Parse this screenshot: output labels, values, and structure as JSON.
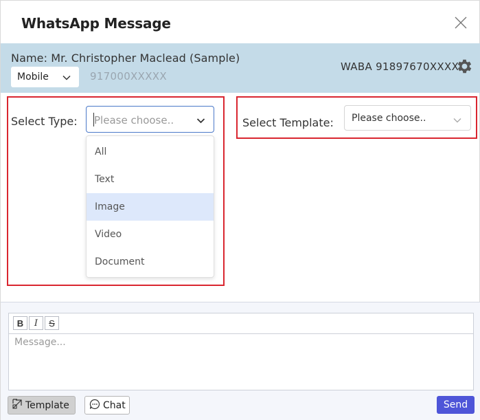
{
  "modal": {
    "title": "WhatsApp Message"
  },
  "contact": {
    "name": "Name: Mr. Christopher Maclead (Sample)",
    "phone_type": "Mobile",
    "phone_number": "917000XXXXX",
    "waba": "WABA 91897670XXXX"
  },
  "select_type": {
    "label": "Select Type:",
    "placeholder": "Please choose..",
    "options": [
      {
        "label": "All",
        "highlighted": false
      },
      {
        "label": "Text",
        "highlighted": false
      },
      {
        "label": "Image",
        "highlighted": true
      },
      {
        "label": "Video",
        "highlighted": false
      },
      {
        "label": "Document",
        "highlighted": false
      }
    ]
  },
  "select_template": {
    "label": "Select Template:",
    "placeholder": "Please choose.."
  },
  "composer": {
    "toolbar": {
      "bold": "B",
      "italic": "I",
      "strike": "S"
    },
    "message_placeholder": "Message...",
    "template_button": "Template",
    "chat_button": "Chat",
    "send_button": "Send"
  },
  "colors": {
    "infobar_bg": "#c4dbe8",
    "highlight_box": "#d9252f",
    "send_bg": "#4e55d8",
    "option_highlight": "#dde8fb"
  },
  "icons": {
    "close": "close-icon",
    "gear": "gear-icon",
    "chevron": "chevron-down-icon",
    "template": "template-icon",
    "chat": "chat-bubble-icon"
  }
}
